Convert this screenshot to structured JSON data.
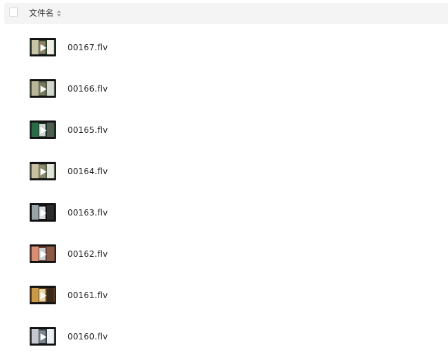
{
  "header": {
    "column_name": "文件名",
    "sort_icon": "sort-icon"
  },
  "files": [
    {
      "name": "00167.flv",
      "icon": "video-thumbnail",
      "palette": [
        "#30402f",
        "#c7c4a7",
        "#8b8467",
        "#efefe7"
      ]
    },
    {
      "name": "00166.flv",
      "icon": "video-thumbnail",
      "palette": [
        "#4e5a47",
        "#b8b59a",
        "#7a7a5f",
        "#d4d7cf"
      ]
    },
    {
      "name": "00165.flv",
      "icon": "video-thumbnail",
      "palette": [
        "#1b3326",
        "#2b6b47",
        "#d0d4d0",
        "#4f5e50"
      ]
    },
    {
      "name": "00164.flv",
      "icon": "video-thumbnail",
      "palette": [
        "#55614a",
        "#c8c0a0",
        "#8f8b6d",
        "#e3e6dc"
      ]
    },
    {
      "name": "00163.flv",
      "icon": "video-thumbnail",
      "palette": [
        "#101010",
        "#9aa3a8",
        "#d9dde0",
        "#2c2c2c"
      ]
    },
    {
      "name": "00162.flv",
      "icon": "video-thumbnail",
      "palette": [
        "#6b3d35",
        "#d68f73",
        "#c8d1d5",
        "#8a5a45"
      ]
    },
    {
      "name": "00161.flv",
      "icon": "video-thumbnail",
      "palette": [
        "#5a3d22",
        "#c99a47",
        "#e9d7a8",
        "#3b2a1a"
      ]
    },
    {
      "name": "00160.flv",
      "icon": "video-thumbnail",
      "palette": [
        "#3a3f44",
        "#c5c9cf",
        "#7c8790",
        "#eceff2"
      ]
    }
  ]
}
